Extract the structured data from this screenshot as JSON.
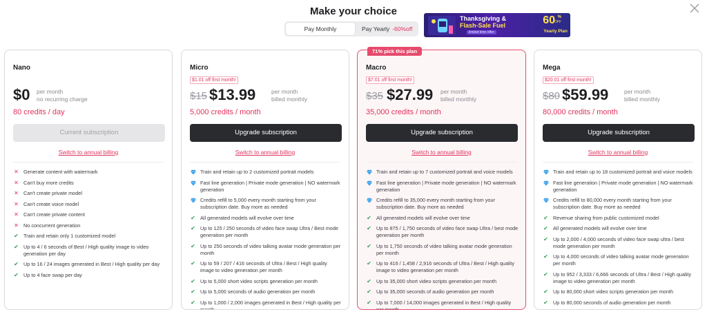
{
  "header": {
    "title": "Make your choice"
  },
  "billing_toggle": {
    "monthly": "Pay Monthly",
    "yearly": "Pay Yearly",
    "yearly_discount": "-60%off"
  },
  "promo": {
    "line1": "Thanksgiving &",
    "line2": "Flash-Sale Fuel",
    "line3": "limited time offer",
    "percent": "60",
    "percent_sym": "%",
    "off": "OFF",
    "plan": "Yearly Plan"
  },
  "plans": [
    {
      "name": "Nano",
      "price": "$0",
      "per_line1": "per month",
      "per_line2": "no recurring charge",
      "credits": "80 credits / day",
      "button": "Current subscription",
      "link": "Switch to annual billing",
      "features": [
        {
          "icon": "x",
          "text": "Generate content with watermark"
        },
        {
          "icon": "x",
          "text": "Can't buy more credits"
        },
        {
          "icon": "x",
          "text": "Can't create private model"
        },
        {
          "icon": "x",
          "text": "Can't create voice model"
        },
        {
          "icon": "x",
          "text": "Can't create private content"
        },
        {
          "icon": "x",
          "text": "No concurrent generation"
        },
        {
          "icon": "check",
          "text": "Train and retain only 1 customized model"
        },
        {
          "icon": "check",
          "text": "Up to 4 / 6 seconds of Best / High quality image to video generation per day"
        },
        {
          "icon": "check",
          "text": "Up to 16 / 24 images generated in Best / High quality per day"
        },
        {
          "icon": "check",
          "text": "Up to 4 face swap per day"
        }
      ]
    },
    {
      "name": "Micro",
      "tag": "$1.01 off first month!",
      "old_price": "$15",
      "price": "$13.99",
      "per_line1": "per month",
      "per_line2": "billed monthly",
      "credits": "5,000 credits / month",
      "button": "Upgrade subscription",
      "link": "Switch to annual billing",
      "features": [
        {
          "icon": "gem",
          "text": "Train and retain up to 2 customized portrait models"
        },
        {
          "icon": "gem",
          "text": "Fast line generation | Private mode generation | NO watermark generation"
        },
        {
          "icon": "gem",
          "text": "Credits refill to 5,000 every month starting from your subscription date. Buy more as needed"
        },
        {
          "icon": "check",
          "text": "All generated models will evolve over time"
        },
        {
          "icon": "check",
          "text": "Up to 125 / 250 seconds of video face swap Ultra / Best mode generation per month"
        },
        {
          "icon": "check",
          "text": "Up to 250 seconds of video talking avatar mode generation per month"
        },
        {
          "icon": "check",
          "text": "Up to 59 / 207 / 416 seconds of Ultra / Best / High quality image to video generation per month"
        },
        {
          "icon": "check",
          "text": "Up to 5,000 short video scripts generation per month"
        },
        {
          "icon": "check",
          "text": "Up to 5,000 seconds of audio generation per month"
        },
        {
          "icon": "check",
          "text": "Up to 1,000 / 2,000 images generated in Best / High quality per month"
        }
      ]
    },
    {
      "name": "Macro",
      "badge": "71% pick this plan",
      "tag": "$7.01 off first month!",
      "old_price": "$35",
      "price": "$27.99",
      "per_line1": "per month",
      "per_line2": "billed monthly",
      "credits": "35,000 credits / month",
      "button": "Upgrade subscription",
      "link": "Switch to annual billing",
      "features": [
        {
          "icon": "gem",
          "text": "Train and retain up to 7 customized portrait and voice models"
        },
        {
          "icon": "gem",
          "text": "Fast line generation | Private mode generation | NO watermark generation"
        },
        {
          "icon": "gem",
          "text": "Credits refill to 35,000 every month starting from your subscription date. Buy more as needed"
        },
        {
          "icon": "check",
          "text": "All generated models will evolve over time"
        },
        {
          "icon": "check",
          "text": "Up to 875 / 1,750 seconds of video face swap Ultra / best mode generation per month"
        },
        {
          "icon": "check",
          "text": "Up to 1,750 seconds of video talking avatar mode generation per month"
        },
        {
          "icon": "check",
          "text": "Up to 416 / 1,458 / 2,916 seconds of Ultra / Best / High quality image to video generation per month"
        },
        {
          "icon": "check",
          "text": "Up to 35,000 short video scripts generation per month"
        },
        {
          "icon": "check",
          "text": "Up to 35,000 seconds of audio generation per month"
        },
        {
          "icon": "check",
          "text": "Up to 7,000 / 14,000 images generated in Best / High quality per month"
        }
      ]
    },
    {
      "name": "Mega",
      "tag": "$20.01 off first month!",
      "old_price": "$80",
      "price": "$59.99",
      "per_line1": "per month",
      "per_line2": "billed monthly",
      "credits": "80,000 credits / month",
      "button": "Upgrade subscription",
      "link": "Switch to annual billing",
      "features": [
        {
          "icon": "gem",
          "text": "Train and retain up to 18 customized portrait and voice models"
        },
        {
          "icon": "gem",
          "text": "Fast line generation | Private mode generation | NO watermark generation"
        },
        {
          "icon": "gem",
          "text": "Credits refill to 80,000 every month starting from your subscription date. Buy more as needed"
        },
        {
          "icon": "check",
          "text": "Revenue sharing from public customized model"
        },
        {
          "icon": "check",
          "text": "All generated models will evolve over time"
        },
        {
          "icon": "check",
          "text": "Up to 2,000 / 4,000 seconds of video face swap ultra / best mode generation per month"
        },
        {
          "icon": "check",
          "text": "Up to 4,000 seconds of video talking avatar mode generation per month"
        },
        {
          "icon": "check",
          "text": "Up to 952 / 3,333 / 6,666 seconds of Ultra / Best / High quality image to video generation per month"
        },
        {
          "icon": "check",
          "text": "Up to 80,000 short video scripts generation per month"
        },
        {
          "icon": "check",
          "text": "Up to 80,000 seconds of audio generation per month"
        }
      ]
    }
  ],
  "colors": {
    "accent": "#e0335d",
    "button_dark": "#2a2b2f",
    "check": "#2e9e54",
    "gem": "#3aa0ea"
  }
}
